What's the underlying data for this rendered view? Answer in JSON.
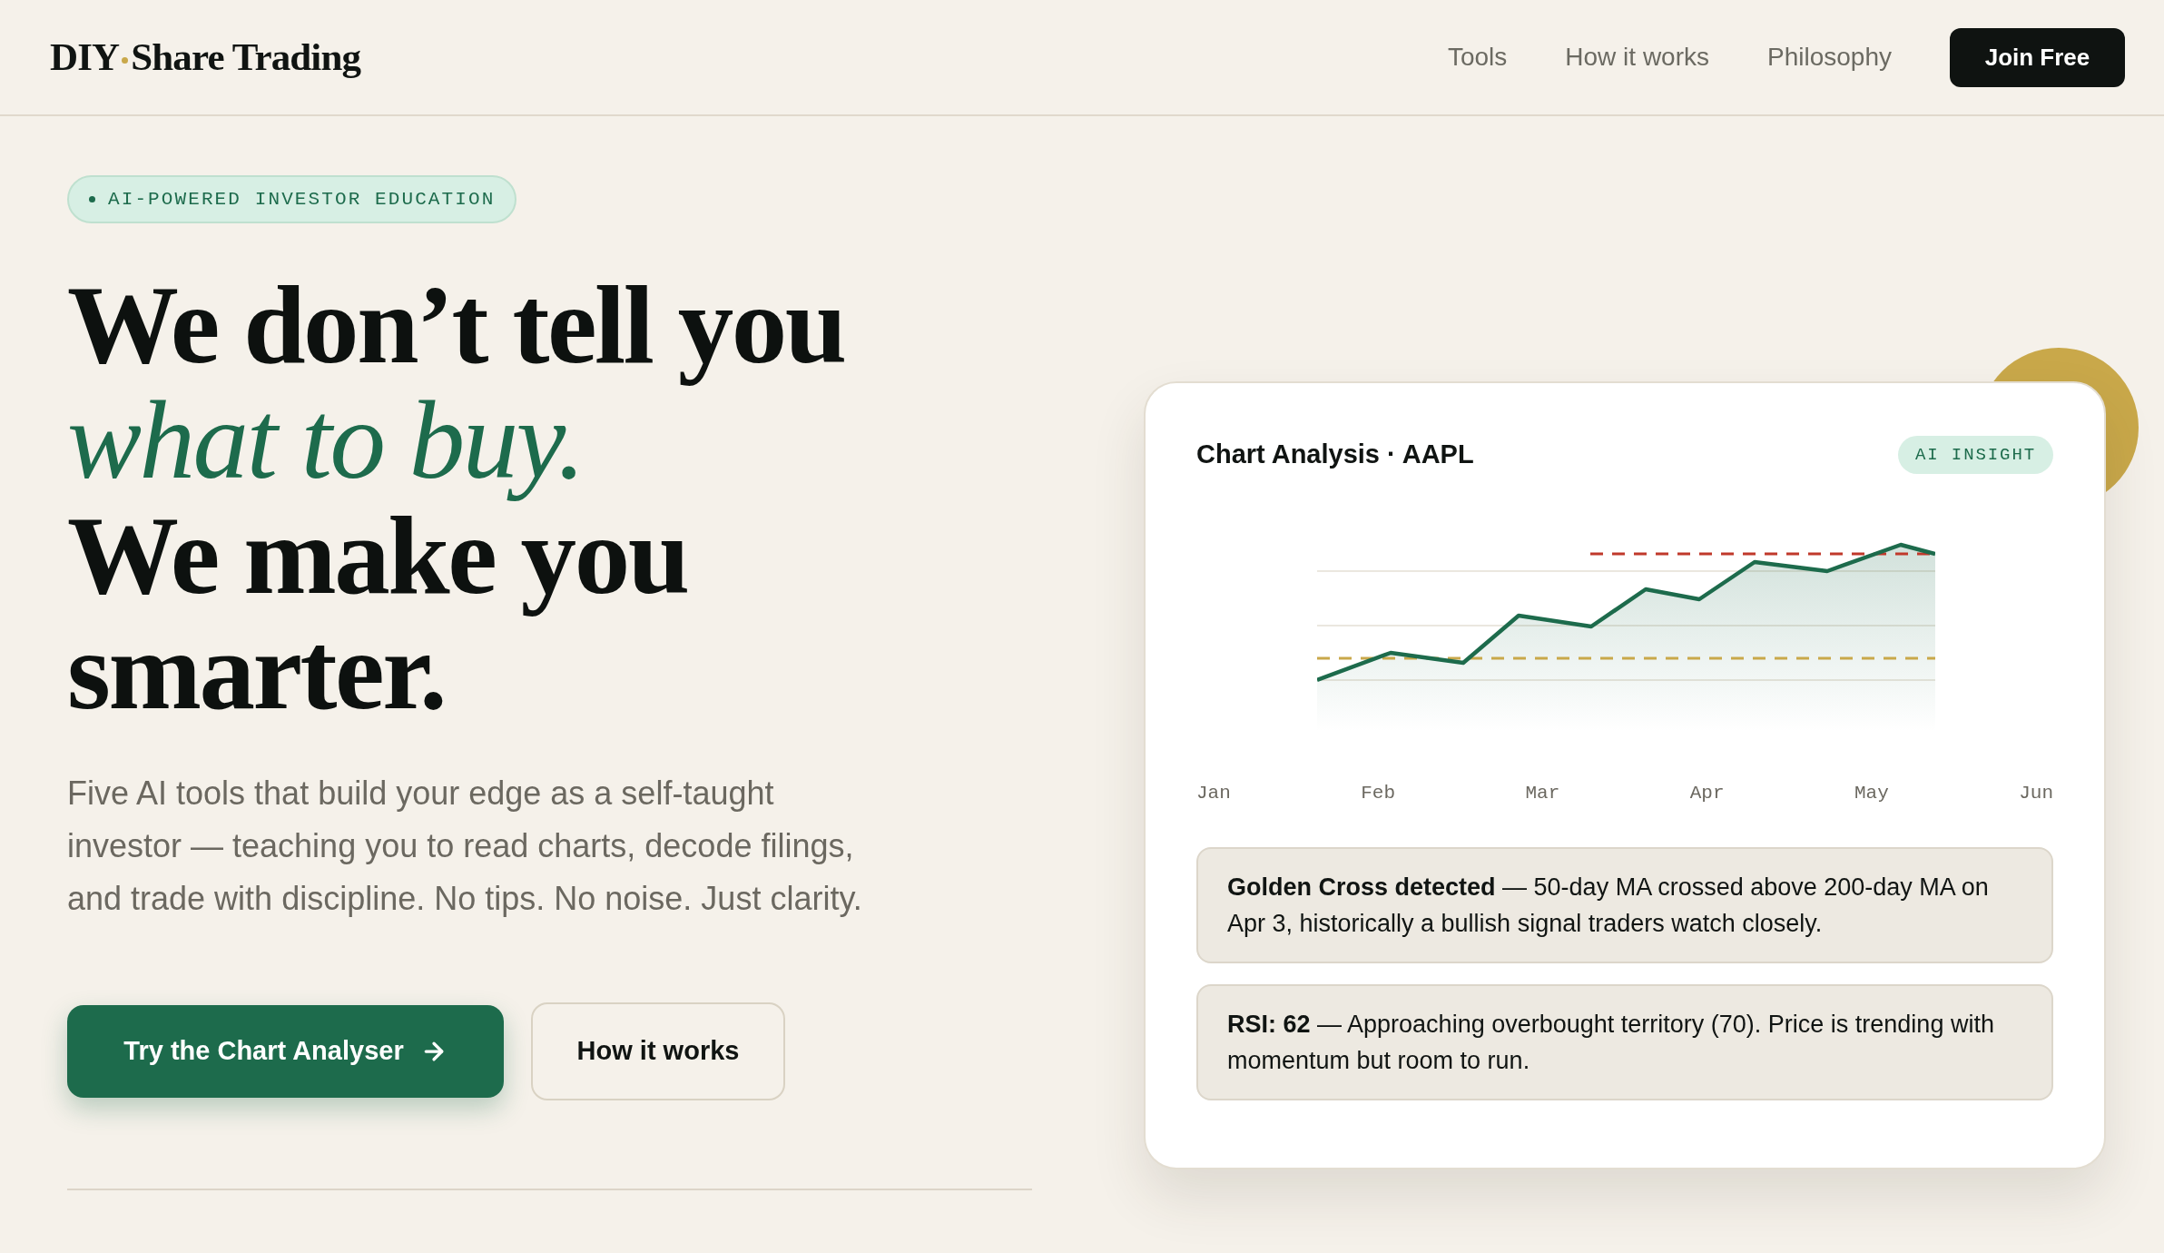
{
  "header": {
    "logo": {
      "prefix": "DIY",
      "name": "Share Trading"
    },
    "nav": [
      "Tools",
      "How it works",
      "Philosophy"
    ],
    "cta": "Join Free"
  },
  "hero": {
    "badge": "AI-POWERED INVESTOR EDUCATION",
    "headline": {
      "lead": "We don’t tell you",
      "emphasis": "what to buy.",
      "close": "We make you smarter."
    },
    "description": "Five AI tools that build your edge as a self-taught investor — teaching you to read charts, decode filings, and trade with discipline. No tips. No noise. Just clarity.",
    "buttons": [
      {
        "label": "Try the Chart Analyser",
        "kind": "primary"
      },
      {
        "label": "How it works",
        "kind": "secondary"
      }
    ]
  },
  "card": {
    "title": "Chart Analysis · AAPL",
    "tag": "AI INSIGHT",
    "chart": {
      "month_labels": [
        "Jan",
        "Feb",
        "Mar",
        "Apr",
        "May",
        "Jun"
      ]
    },
    "insights": [
      "**Golden Cross detected** — 50-day MA crossed above 200-day MA on Apr 3, historically a bullish signal traders watch closely.",
      "**RSI: 62** — Approaching overbought territory (70). Price is trending with momentum but room to run."
    ]
  }
}
